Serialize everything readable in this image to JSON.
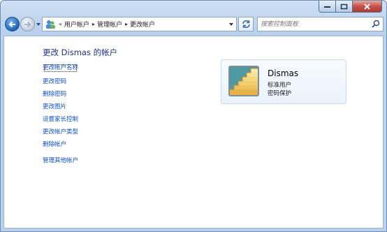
{
  "window": {
    "caption_buttons": [
      "minimize-icon",
      "maximize-icon",
      "close-icon"
    ]
  },
  "toolbar": {
    "breadcrumb_overflow": "«",
    "breadcrumbs": [
      "用户帐户",
      "管理帐户",
      "更改帐户"
    ],
    "breadcrumb_separator": "▸",
    "search_placeholder": "搜索控制面板"
  },
  "main": {
    "title": "更改 Dismas 的帐户",
    "tasks": [
      "更改帐户名称",
      "更改密码",
      "删除密码",
      "更改图片",
      "设置家长控制",
      "更改帐户类型",
      "删除帐户"
    ],
    "other_link": "管理其他帐户"
  },
  "account": {
    "name": "Dismas",
    "type": "标准用户",
    "password_status": "密码保护",
    "picture_icon": "staircase-picture"
  },
  "colors": {
    "link": "#0c4ed4",
    "title": "#1e3287",
    "frame": "#b9d1ec"
  }
}
